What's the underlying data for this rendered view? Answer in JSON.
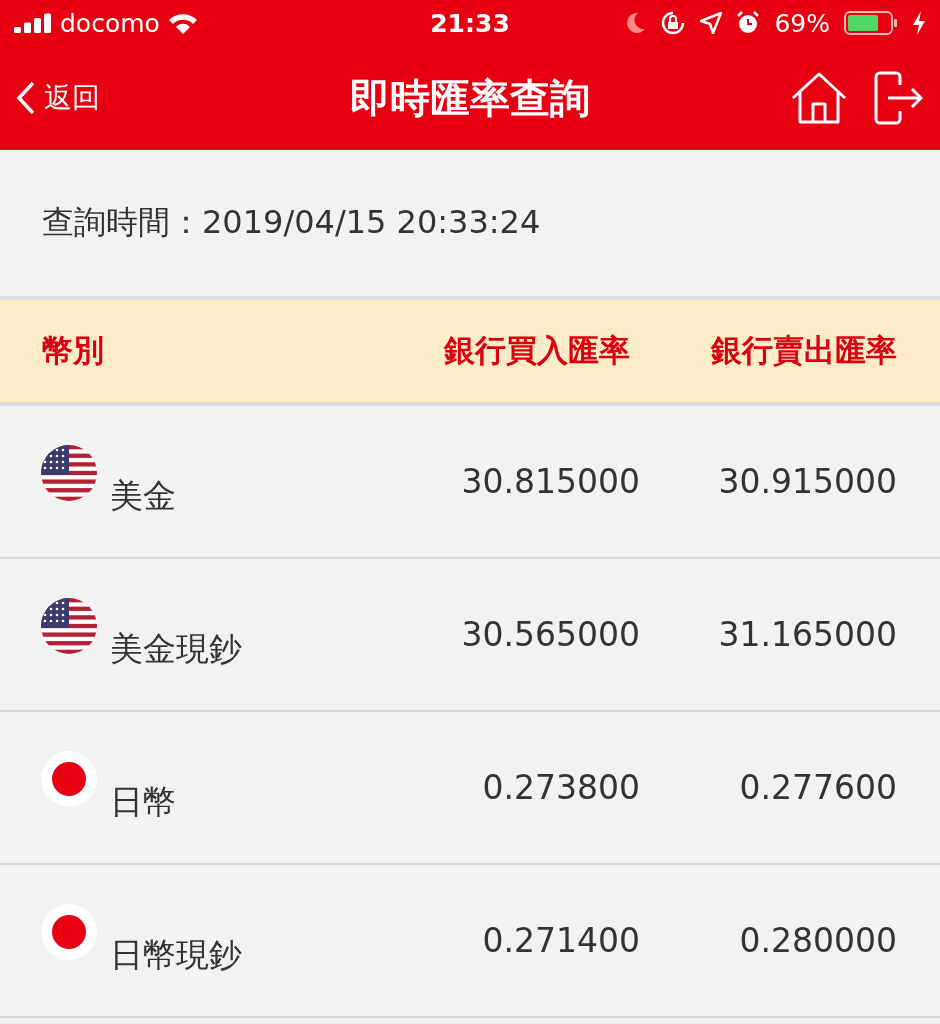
{
  "status_bar": {
    "carrier": "docomo",
    "time": "21:33",
    "battery": "69%"
  },
  "nav": {
    "back": "返回",
    "title": "即時匯率查詢"
  },
  "query_time": {
    "label": "查詢時間：",
    "value": "2019/04/15 20:33:24"
  },
  "table": {
    "columns": [
      "幣別",
      "銀行買入匯率",
      "銀行賣出匯率"
    ],
    "rows": [
      {
        "kind": "us",
        "currency": "美金",
        "buy": "30.815000",
        "sell": "30.915000"
      },
      {
        "kind": "us",
        "currency": "美金現鈔",
        "buy": "30.565000",
        "sell": "31.165000"
      },
      {
        "kind": "jp",
        "currency": "日幣",
        "buy": "0.273800",
        "sell": "0.277600"
      },
      {
        "kind": "jp",
        "currency": "日幣現鈔",
        "buy": "0.271400",
        "sell": "0.280000"
      }
    ]
  }
}
